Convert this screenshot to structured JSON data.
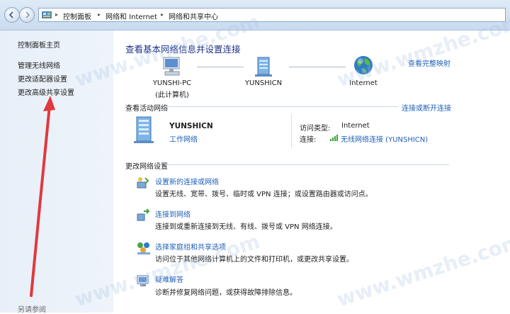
{
  "address_bar": {
    "crumbs": [
      "控制面板",
      "网络和 Internet",
      "网络和共享中心"
    ]
  },
  "sidebar": {
    "home": "控制面板主页",
    "links": [
      "管理无线网络",
      "更改适配器设置",
      "更改高级共享设置"
    ],
    "see_also": "另请参阅"
  },
  "main": {
    "title": "查看基本网络信息并设置连接",
    "view_full_map": "查看完整映射",
    "nodes": {
      "computer_name": "YUNSHI-PC",
      "computer_sub": "(此计算机)",
      "network_name": "YUNSHICN",
      "internet_name": "Internet"
    },
    "active_networks": {
      "title": "查看活动网络",
      "connect_disconnect": "连接或断开连接",
      "network_name": "YUNSHICN",
      "network_type": "工作网络",
      "access_type_label": "访问类型:",
      "access_type_value": "Internet",
      "connection_label": "连接:",
      "connection_value": "无线网络连接 (YUNSHICN)"
    },
    "change_settings": {
      "title": "更改网络设置",
      "items": [
        {
          "title": "设置新的连接或网络",
          "desc": "设置无线、宽带、拨号、临时或 VPN 连接；或设置路由器或访问点。"
        },
        {
          "title": "连接到网络",
          "desc": "连接到或重新连接到无线、有线、拨号或 VPN 网络连接。"
        },
        {
          "title": "选择家庭组和共享选项",
          "desc": "访问位于其他网络计算机上的文件和打印机，或更改共享设置。"
        },
        {
          "title": "疑难解答",
          "desc": "诊断并修复网络问题，或获得故障排除信息。"
        }
      ]
    }
  },
  "watermark": "www.wmzhe.com",
  "colors": {
    "link": "#2060b8",
    "title": "#1e3287",
    "sidebar_bg": "#e7eff8",
    "arrow": "#e0393e"
  }
}
